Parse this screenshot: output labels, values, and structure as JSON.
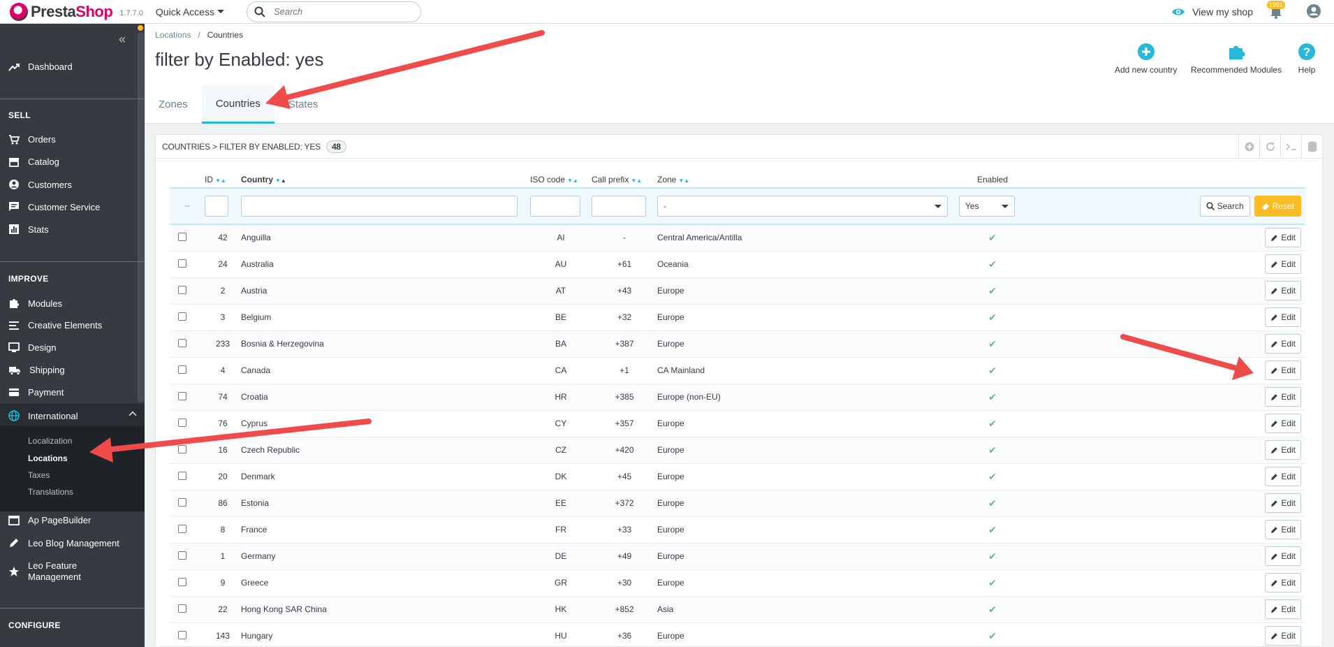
{
  "topbar": {
    "logo_prefix": "Presta",
    "logo_suffix": "Shop",
    "version": "1.7.7.0",
    "quick_access": "Quick Access",
    "search_placeholder": "Search",
    "view_shop": "View my shop",
    "notification_count": "1991"
  },
  "sidebar": {
    "dashboard": "Dashboard",
    "sell_title": "SELL",
    "orders": "Orders",
    "catalog": "Catalog",
    "customers": "Customers",
    "customer_service": "Customer Service",
    "stats": "Stats",
    "improve_title": "IMPROVE",
    "modules": "Modules",
    "creative_elements": "Creative Elements",
    "design": "Design",
    "shipping": "Shipping",
    "payment": "Payment",
    "international": "International",
    "localization": "Localization",
    "locations": "Locations",
    "taxes": "Taxes",
    "translations": "Translations",
    "ap_pagebuilder": "Ap PageBuilder",
    "leo_blog": "Leo Blog Management",
    "leo_feature_1": "Leo Feature",
    "leo_feature_2": "Management",
    "configure_title": "CONFIGURE"
  },
  "header": {
    "breadcrumb_parent": "Locations",
    "breadcrumb_sep": "/",
    "breadcrumb_current": "Countries",
    "title": "filter by Enabled: yes",
    "add_country": "Add new country",
    "recommended_modules": "Recommended Modules",
    "help": "Help",
    "tabs": [
      "Zones",
      "Countries",
      "States"
    ]
  },
  "panel": {
    "heading": "COUNTRIES > FILTER BY ENABLED: YES",
    "count": "48",
    "columns": {
      "id": "ID",
      "country": "Country",
      "iso": "ISO code",
      "prefix": "Call prefix",
      "zone": "Zone",
      "enabled": "Enabled"
    },
    "filter": {
      "bulk": "--",
      "zone_value": "-",
      "enabled_value": "Yes",
      "search_button": "Search",
      "reset_button": "Reset"
    },
    "edit_label": "Edit",
    "check_glyph": "✔",
    "rows": [
      {
        "id": "42",
        "country": "Anguilla",
        "iso": "AI",
        "prefix": "-",
        "zone": "Central America/Antilla"
      },
      {
        "id": "24",
        "country": "Australia",
        "iso": "AU",
        "prefix": "+61",
        "zone": "Oceania"
      },
      {
        "id": "2",
        "country": "Austria",
        "iso": "AT",
        "prefix": "+43",
        "zone": "Europe"
      },
      {
        "id": "3",
        "country": "Belgium",
        "iso": "BE",
        "prefix": "+32",
        "zone": "Europe"
      },
      {
        "id": "233",
        "country": "Bosnia & Herzegovina",
        "iso": "BA",
        "prefix": "+387",
        "zone": "Europe"
      },
      {
        "id": "4",
        "country": "Canada",
        "iso": "CA",
        "prefix": "+1",
        "zone": "CA Mainland"
      },
      {
        "id": "74",
        "country": "Croatia",
        "iso": "HR",
        "prefix": "+385",
        "zone": "Europe (non-EU)"
      },
      {
        "id": "76",
        "country": "Cyprus",
        "iso": "CY",
        "prefix": "+357",
        "zone": "Europe"
      },
      {
        "id": "16",
        "country": "Czech Republic",
        "iso": "CZ",
        "prefix": "+420",
        "zone": "Europe"
      },
      {
        "id": "20",
        "country": "Denmark",
        "iso": "DK",
        "prefix": "+45",
        "zone": "Europe"
      },
      {
        "id": "86",
        "country": "Estonia",
        "iso": "EE",
        "prefix": "+372",
        "zone": "Europe"
      },
      {
        "id": "8",
        "country": "France",
        "iso": "FR",
        "prefix": "+33",
        "zone": "Europe"
      },
      {
        "id": "1",
        "country": "Germany",
        "iso": "DE",
        "prefix": "+49",
        "zone": "Europe"
      },
      {
        "id": "9",
        "country": "Greece",
        "iso": "GR",
        "prefix": "+30",
        "zone": "Europe"
      },
      {
        "id": "22",
        "country": "Hong Kong SAR China",
        "iso": "HK",
        "prefix": "+852",
        "zone": "Asia"
      },
      {
        "id": "143",
        "country": "Hungary",
        "iso": "HU",
        "prefix": "+36",
        "zone": "Europe"
      }
    ]
  },
  "colors": {
    "accent": "#25b9d7",
    "sidebar": "#363a41",
    "reset": "#fbbb22",
    "annotation_arrow": "#ef4b4b",
    "brand_pink": "#df0067"
  }
}
